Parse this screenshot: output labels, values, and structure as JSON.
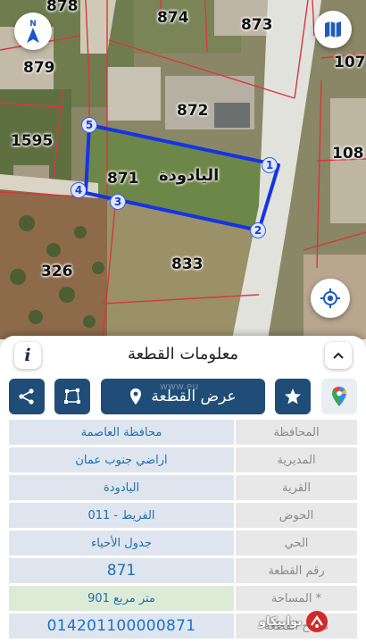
{
  "map": {
    "parcels": {
      "p878": "878",
      "p874": "874",
      "p873": "873",
      "p107": "107",
      "p879": "879",
      "p872": "872",
      "p1595": "1595",
      "p108": "108",
      "p871": "871",
      "p326": "326",
      "p833": "833"
    },
    "selected_parcel_name": "اليادودة",
    "vertices": [
      "1",
      "2",
      "3",
      "4",
      "5"
    ],
    "colors": {
      "boundary": "#1533e6",
      "road": "#e2e2dc",
      "parcel_line": "#d9363e"
    }
  },
  "panel": {
    "title": "معلومات القطعة",
    "view_parcel_label": "عرض القطعة",
    "watermark": "www.eu",
    "rows": [
      {
        "label": "المحافظة",
        "value": "محافظة العاصمة"
      },
      {
        "label": "المديرية",
        "value": "اراضي جنوب عمان"
      },
      {
        "label": "القرية",
        "value": "اليادودة"
      },
      {
        "label": "الحوض",
        "value": "الفريط - 011"
      },
      {
        "label": "الحي",
        "value": "جدول الأحياء"
      },
      {
        "label": "رقم القطعة",
        "value": "871"
      },
      {
        "label": "المساحة *",
        "value": "901  متر مربع"
      },
      {
        "label": "مفتاح القطعة",
        "value": "014201100000871"
      }
    ],
    "brand": "بوابيكاو"
  }
}
